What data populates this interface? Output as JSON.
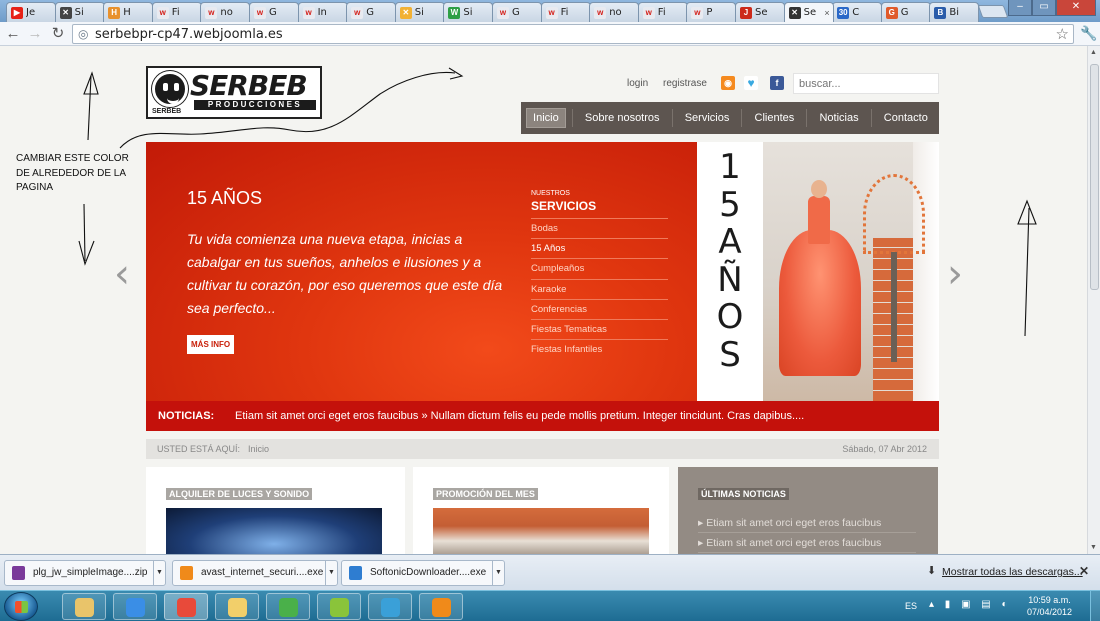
{
  "browser": {
    "tabs": [
      {
        "label": "Je",
        "color": "#e62117",
        "glyph": "▶"
      },
      {
        "label": "Si",
        "color": "#444",
        "glyph": "✕"
      },
      {
        "label": "H",
        "color": "#e8912d",
        "glyph": "H"
      },
      {
        "label": "Fi",
        "color": "#e8eaf0",
        "glyph": "w"
      },
      {
        "label": "no",
        "color": "#e8eaf0",
        "glyph": "w"
      },
      {
        "label": "G",
        "color": "#e8eaf0",
        "glyph": "w"
      },
      {
        "label": "In",
        "color": "#e8eaf0",
        "glyph": "w"
      },
      {
        "label": "G",
        "color": "#e8eaf0",
        "glyph": "w"
      },
      {
        "label": "Si",
        "color": "#f2b134",
        "glyph": "✕"
      },
      {
        "label": "Si",
        "color": "#2e9f45",
        "glyph": "W"
      },
      {
        "label": "G",
        "color": "#e8eaf0",
        "glyph": "w"
      },
      {
        "label": "Fi",
        "color": "#e8eaf0",
        "glyph": "w"
      },
      {
        "label": "no",
        "color": "#e8eaf0",
        "glyph": "w"
      },
      {
        "label": "Fi",
        "color": "#e8eaf0",
        "glyph": "w"
      },
      {
        "label": "P",
        "color": "#e8eaf0",
        "glyph": "w"
      },
      {
        "label": "Se",
        "color": "#cc2a1a",
        "glyph": "J"
      },
      {
        "label": "Se",
        "color": "#333",
        "glyph": "✕"
      },
      {
        "label": "C",
        "color": "#2a68c8",
        "glyph": "30"
      },
      {
        "label": "G",
        "color": "#e05a2a",
        "glyph": "G"
      },
      {
        "label": "Bi",
        "color": "#2a5caa",
        "glyph": "B"
      }
    ],
    "active_tab_index": 16,
    "url": "serbebpr-cp47.webjoomla.es",
    "window_buttons": [
      "–",
      "▭",
      "✕"
    ]
  },
  "site": {
    "logo": {
      "brand": "SERBEB",
      "sub": "PRODUCCIONES",
      "small": "SERBEB"
    },
    "top_links": {
      "login": "login",
      "register": "registrase"
    },
    "search_placeholder": "buscar...",
    "nav": [
      "Inicio",
      "Sobre nosotros",
      "Servicios",
      "Clientes",
      "Noticias",
      "Contacto"
    ],
    "hero": {
      "title": "15 AÑOS",
      "description": "Tu vida comienza una nueva etapa, inicias a cabalgar en tus sueños, anhelos e ilusiones y a cultivar tu corazón, por eso queremos que este día sea perfecto...",
      "button": "MÁS INFO",
      "services_heading_small": "NUESTROS",
      "services_heading": "SERVICIOS",
      "services": [
        "Bodas",
        "15 Años",
        "Cumpleaños",
        "Karaoke",
        "Conferencias",
        "Fiestas Tematicas",
        "Fiestas Infantiles"
      ],
      "vertical_text": [
        "1",
        "5",
        "A",
        "Ñ",
        "O",
        "S"
      ]
    },
    "ticker": {
      "label": "NOTICIAS:",
      "text": "Etiam sit amet orci eget eros faucibus » Nullam dictum felis eu pede mollis pretium. Integer tincidunt. Cras dapibus...."
    },
    "breadcrumb": {
      "label": "USTED ESTÁ AQUÍ:",
      "current": "Inicio",
      "date": "Sábado, 07 Abr 2012"
    },
    "boxes": {
      "rental": "ALQUILER DE LUCES Y SONIDO",
      "promo": "PROMOCIÓN DEL MES",
      "news_title": "ÚLTIMAS NOTICIAS",
      "news_items": [
        "Etiam sit amet orci eget eros faucibus",
        "Etiam sit amet orci eget eros faucibus"
      ]
    }
  },
  "annotation": {
    "text_lines": [
      "CAMBIAR ESTE COLOR",
      "DE ALREDEDOR DE LA",
      "PAGINA"
    ]
  },
  "downloads": {
    "items": [
      {
        "name": "plg_jw_simpleImage....zip",
        "color": "#7a3a9a"
      },
      {
        "name": "avast_internet_securi....exe",
        "color": "#f08a1a"
      },
      {
        "name": "SoftonicDownloader....exe",
        "color": "#2e7dd1"
      }
    ],
    "show_all": "Mostrar todas las descargas...",
    "close": "✕"
  },
  "taskbar": {
    "lang": "ES",
    "time": "10:59 a.m.",
    "date": "07/04/2012",
    "apps": [
      {
        "name": "explorer",
        "color": "#e9c46a"
      },
      {
        "name": "internet-explorer",
        "color": "#3a8ee6"
      },
      {
        "name": "chrome",
        "color": "#e84a3a"
      },
      {
        "name": "folder",
        "color": "#f2cf6a"
      },
      {
        "name": "messenger",
        "color": "#4ab04a"
      },
      {
        "name": "notepad",
        "color": "#8ac43a"
      },
      {
        "name": "paint",
        "color": "#3aa0d8"
      },
      {
        "name": "avast",
        "color": "#f08a1a"
      }
    ]
  }
}
